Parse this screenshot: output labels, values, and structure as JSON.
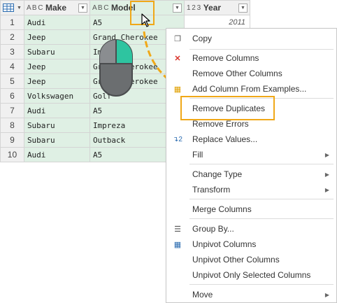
{
  "columns": [
    {
      "type_icon": "A B C",
      "name": "Make"
    },
    {
      "type_icon": "A B C",
      "name": "Model"
    },
    {
      "type_icon": "1 2 3",
      "name": "Year"
    }
  ],
  "rows": [
    {
      "num": "1",
      "make": "Audi",
      "model": "A5",
      "year": "2011"
    },
    {
      "num": "2",
      "make": "Jeep",
      "model": "Grand Cherokee",
      "year": ""
    },
    {
      "num": "3",
      "make": "Subaru",
      "model": "Impreza",
      "year": ""
    },
    {
      "num": "4",
      "make": "Jeep",
      "model": "Grand Cherokee",
      "year": ""
    },
    {
      "num": "5",
      "make": "Jeep",
      "model": "Grand Cherokee",
      "year": ""
    },
    {
      "num": "6",
      "make": "Volkswagen",
      "model": "Golf",
      "year": ""
    },
    {
      "num": "7",
      "make": "Audi",
      "model": "A5",
      "year": ""
    },
    {
      "num": "8",
      "make": "Subaru",
      "model": "Impreza",
      "year": ""
    },
    {
      "num": "9",
      "make": "Subaru",
      "model": "Outback",
      "year": ""
    },
    {
      "num": "10",
      "make": "Audi",
      "model": "A5",
      "year": ""
    }
  ],
  "menu": {
    "copy": "Copy",
    "remove_columns": "Remove Columns",
    "remove_other_columns": "Remove Other Columns",
    "add_column_from_examples": "Add Column From Examples...",
    "remove_duplicates": "Remove Duplicates",
    "remove_errors": "Remove Errors",
    "replace_values": "Replace Values...",
    "fill": "Fill",
    "change_type": "Change Type",
    "transform": "Transform",
    "merge_columns": "Merge Columns",
    "group_by": "Group By...",
    "unpivot_columns": "Unpivot Columns",
    "unpivot_other_columns": "Unpivot Other Columns",
    "unpivot_only_selected_columns": "Unpivot Only Selected Columns",
    "move": "Move"
  },
  "colors": {
    "selected_column": "#dff0e4",
    "highlight": "#f0a818",
    "mouse_button": "#2ec4a0"
  }
}
